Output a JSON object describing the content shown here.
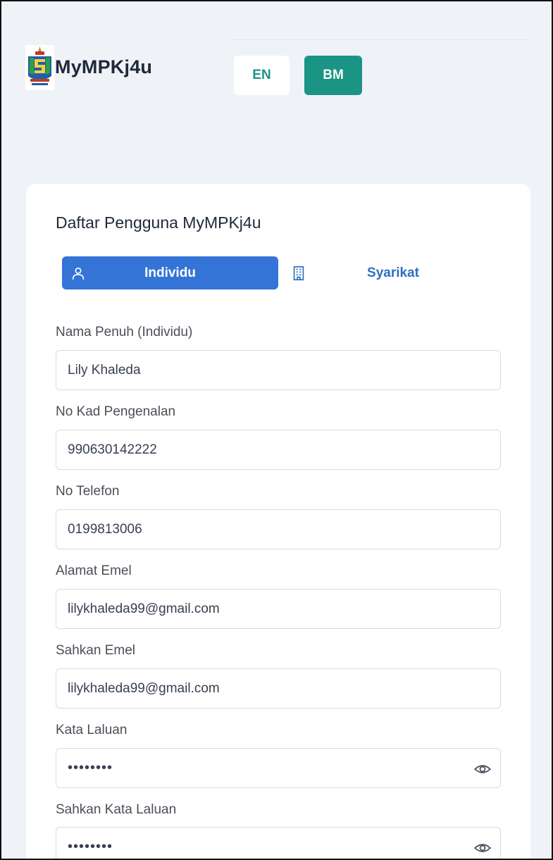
{
  "header": {
    "brand": "MyMPKj4u",
    "lang_en": "EN",
    "lang_bm": "BM"
  },
  "form": {
    "title": "Daftar Pengguna MyMPKj4u",
    "tabs": [
      {
        "label": "Individu",
        "icon": "user-icon",
        "active": true
      },
      {
        "label": "Syarikat",
        "icon": "building-icon",
        "active": false
      }
    ],
    "fields": [
      {
        "label": "Nama Penuh (Individu)",
        "value": "Lily Khaleda"
      },
      {
        "label": "No Kad Pengenalan",
        "value": "990630142222"
      },
      {
        "label": "No Telefon",
        "value": "0199813006"
      },
      {
        "label": "Alamat Emel",
        "value": "lilykhaleda99@gmail.com"
      },
      {
        "label": "Sahkan Emel",
        "value": "lilykhaleda99@gmail.com"
      },
      {
        "label": "Kata Laluan",
        "value": "12345678"
      },
      {
        "label": "Sahkan Kata Laluan",
        "value": "12345678"
      }
    ]
  },
  "colors": {
    "teal": "#1a9484",
    "blue": "#3474d6",
    "background": "#eff3f8"
  }
}
